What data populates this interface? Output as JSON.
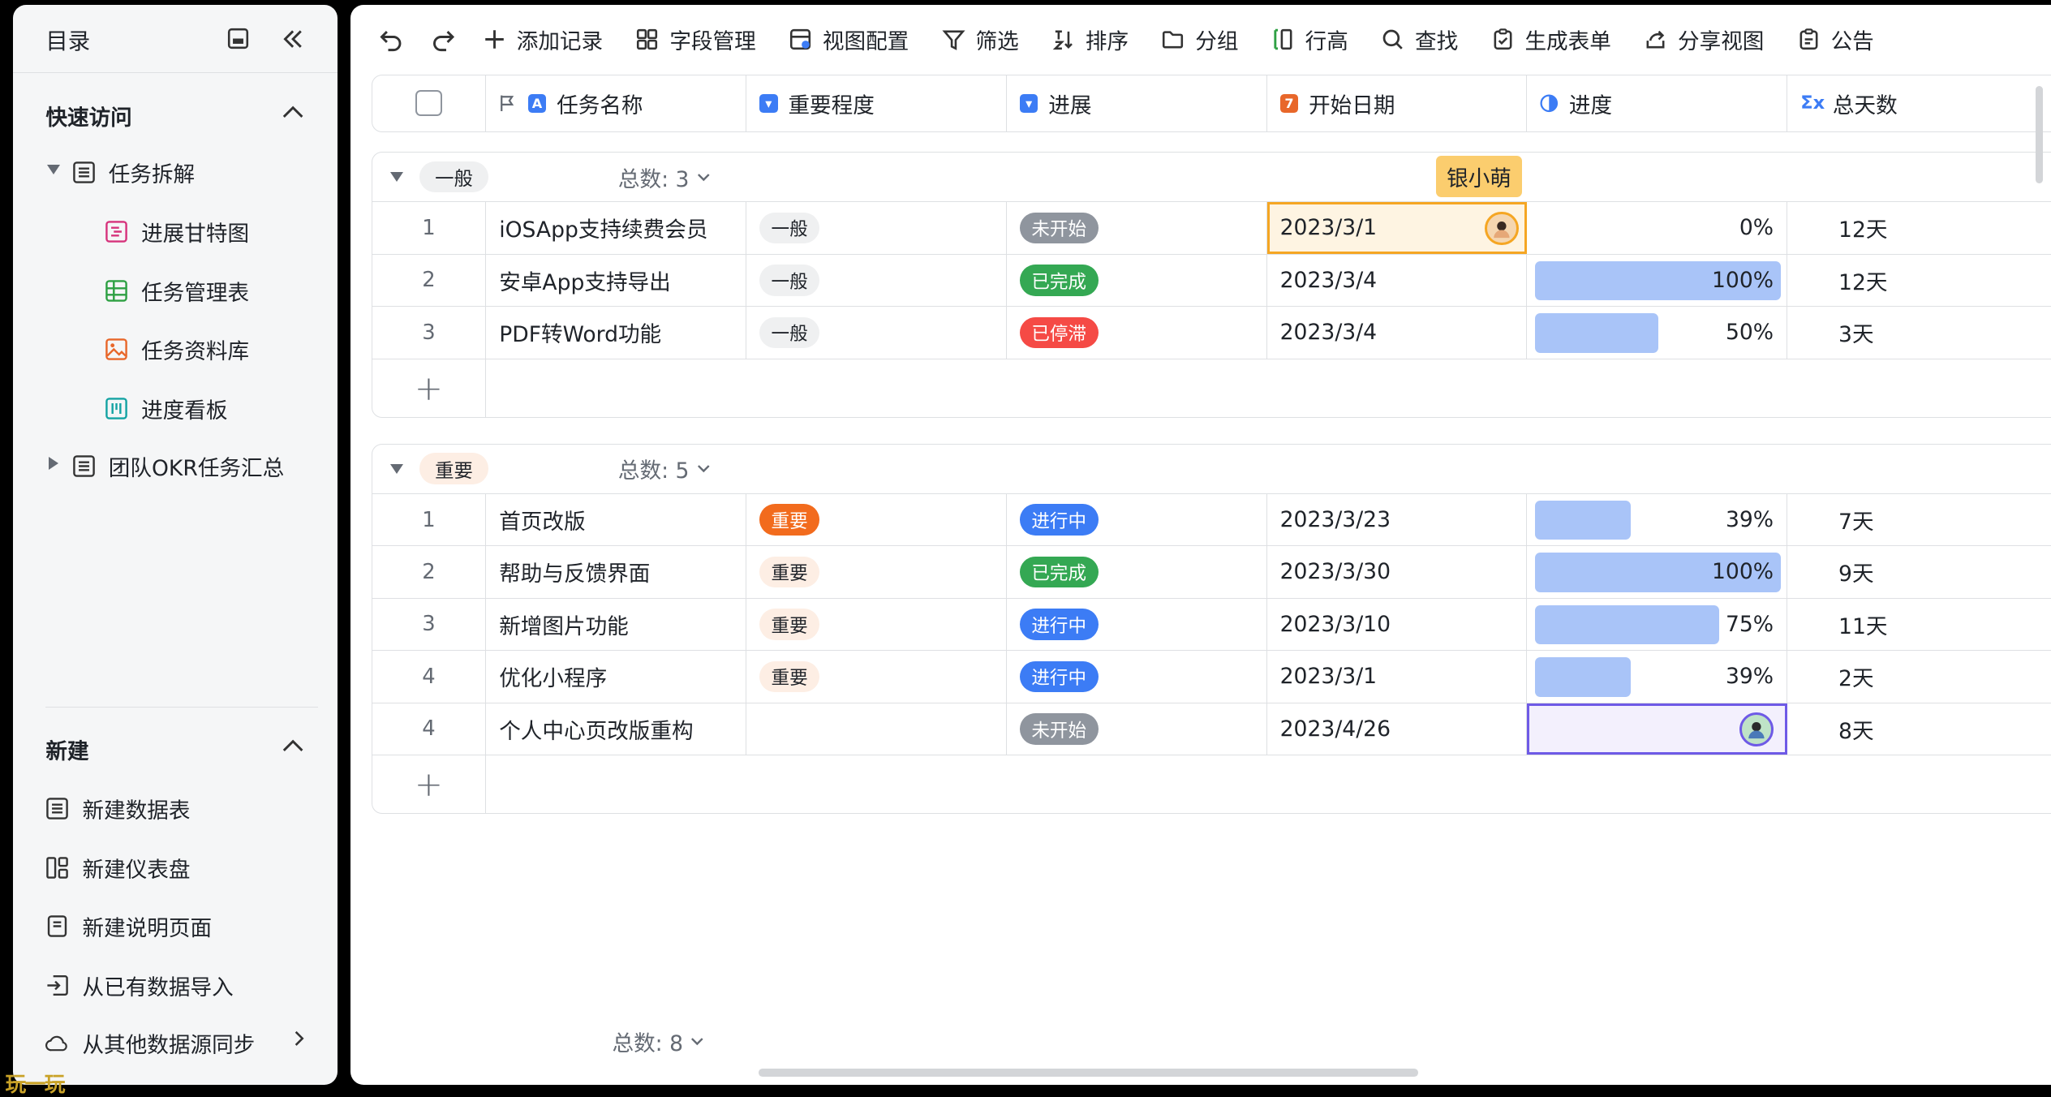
{
  "sidebar": {
    "title": "目录",
    "quick_access": "快速访问",
    "tree": [
      {
        "label": "任务拆解"
      },
      {
        "label": "进展甘特图"
      },
      {
        "label": "任务管理表"
      },
      {
        "label": "任务资料库"
      },
      {
        "label": "进度看板"
      },
      {
        "label": "团队OKR任务汇总"
      }
    ],
    "new_section": "新建",
    "new_items": [
      {
        "label": "新建数据表"
      },
      {
        "label": "新建仪表盘"
      },
      {
        "label": "新建说明页面"
      },
      {
        "label": "从已有数据导入"
      },
      {
        "label": "从其他数据源同步"
      }
    ]
  },
  "toolbar": {
    "items": [
      "添加记录",
      "字段管理",
      "视图配置",
      "筛选",
      "排序",
      "分组",
      "行高",
      "查找",
      "生成表单",
      "分享视图",
      "公告"
    ]
  },
  "columns": [
    "任务名称",
    "重要程度",
    "进展",
    "开始日期",
    "进度",
    "总天数"
  ],
  "groups": [
    {
      "label": "一般",
      "count_text": "总数: 3",
      "rows": [
        {
          "idx": "1",
          "name": "iOSApp支持续费会员",
          "importance": "一般",
          "status": "未开始",
          "date": "2023/3/1",
          "progress": "0%",
          "progress_value": 0,
          "days": "12天"
        },
        {
          "idx": "2",
          "name": "安卓App支持导出",
          "importance": "一般",
          "status": "已完成",
          "date": "2023/3/4",
          "progress": "100%",
          "progress_value": 100,
          "days": "12天"
        },
        {
          "idx": "3",
          "name": "PDF转Word功能",
          "importance": "一般",
          "status": "已停滞",
          "date": "2023/3/4",
          "progress": "50%",
          "progress_value": 50,
          "days": "3天"
        }
      ]
    },
    {
      "label": "重要",
      "count_text": "总数: 5",
      "rows": [
        {
          "idx": "1",
          "name": "首页改版",
          "importance": "重要",
          "status": "进行中",
          "date": "2023/3/23",
          "progress": "39%",
          "progress_value": 39,
          "days": "7天"
        },
        {
          "idx": "2",
          "name": "帮助与反馈界面",
          "importance": "重要",
          "status": "已完成",
          "date": "2023/3/30",
          "progress": "100%",
          "progress_value": 100,
          "days": "9天"
        },
        {
          "idx": "3",
          "name": "新增图片功能",
          "importance": "重要",
          "status": "进行中",
          "date": "2023/3/10",
          "progress": "75%",
          "progress_value": 75,
          "days": "11天"
        },
        {
          "idx": "4",
          "name": "优化小程序",
          "importance": "重要",
          "status": "进行中",
          "date": "2023/3/1",
          "progress": "39%",
          "progress_value": 39,
          "days": "2天"
        },
        {
          "idx": "4",
          "name": "个人中心页改版重构",
          "importance": "",
          "status": "未开始",
          "date": "2023/4/26",
          "progress": "",
          "progress_value": 0,
          "days": "8天"
        }
      ]
    }
  ],
  "footer": {
    "total": "总数: 8"
  },
  "collaborator_label": "银小萌",
  "watermark": "玩一玩",
  "colors": {
    "status_not_started": "#8f959e",
    "status_done": "#34a853",
    "status_stalled": "#f54a45",
    "status_in_progress": "#3c7cf5",
    "importance_important_solid": "#f26b1d",
    "importance_important_light": "#fdeee4",
    "importance_normal": "#eff0f1",
    "progress_fill": "#a9c4f8",
    "selection_orange": "#f5a623",
    "selection_purple": "#6e5ae6"
  }
}
